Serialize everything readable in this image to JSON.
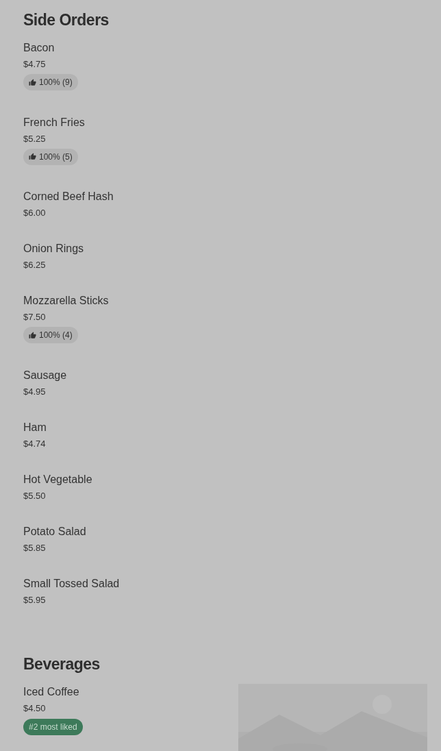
{
  "sections": [
    {
      "title": "Side Orders",
      "items": [
        {
          "name": "Bacon",
          "price": "$4.75",
          "badge": {
            "kind": "rating",
            "text": "100% (9)"
          }
        },
        {
          "name": "French Fries",
          "price": "$5.25",
          "badge": {
            "kind": "rating",
            "text": "100% (5)"
          }
        },
        {
          "name": "Corned Beef Hash",
          "price": "$6.00"
        },
        {
          "name": "Onion Rings",
          "price": "$6.25"
        },
        {
          "name": "Mozzarella Sticks",
          "price": "$7.50",
          "badge": {
            "kind": "rating",
            "text": "100% (4)"
          }
        },
        {
          "name": "Sausage",
          "price": "$4.95"
        },
        {
          "name": "Ham",
          "price": "$4.74"
        },
        {
          "name": "Hot Vegetable",
          "price": "$5.50"
        },
        {
          "name": "Potato Salad",
          "price": "$5.85"
        },
        {
          "name": "Small Tossed Salad",
          "price": "$5.95"
        }
      ]
    },
    {
      "title": "Beverages",
      "items": [
        {
          "name": "Iced Coffee",
          "price": "$4.50",
          "badge": {
            "kind": "rank",
            "text": "#2 most liked"
          }
        }
      ]
    }
  ]
}
